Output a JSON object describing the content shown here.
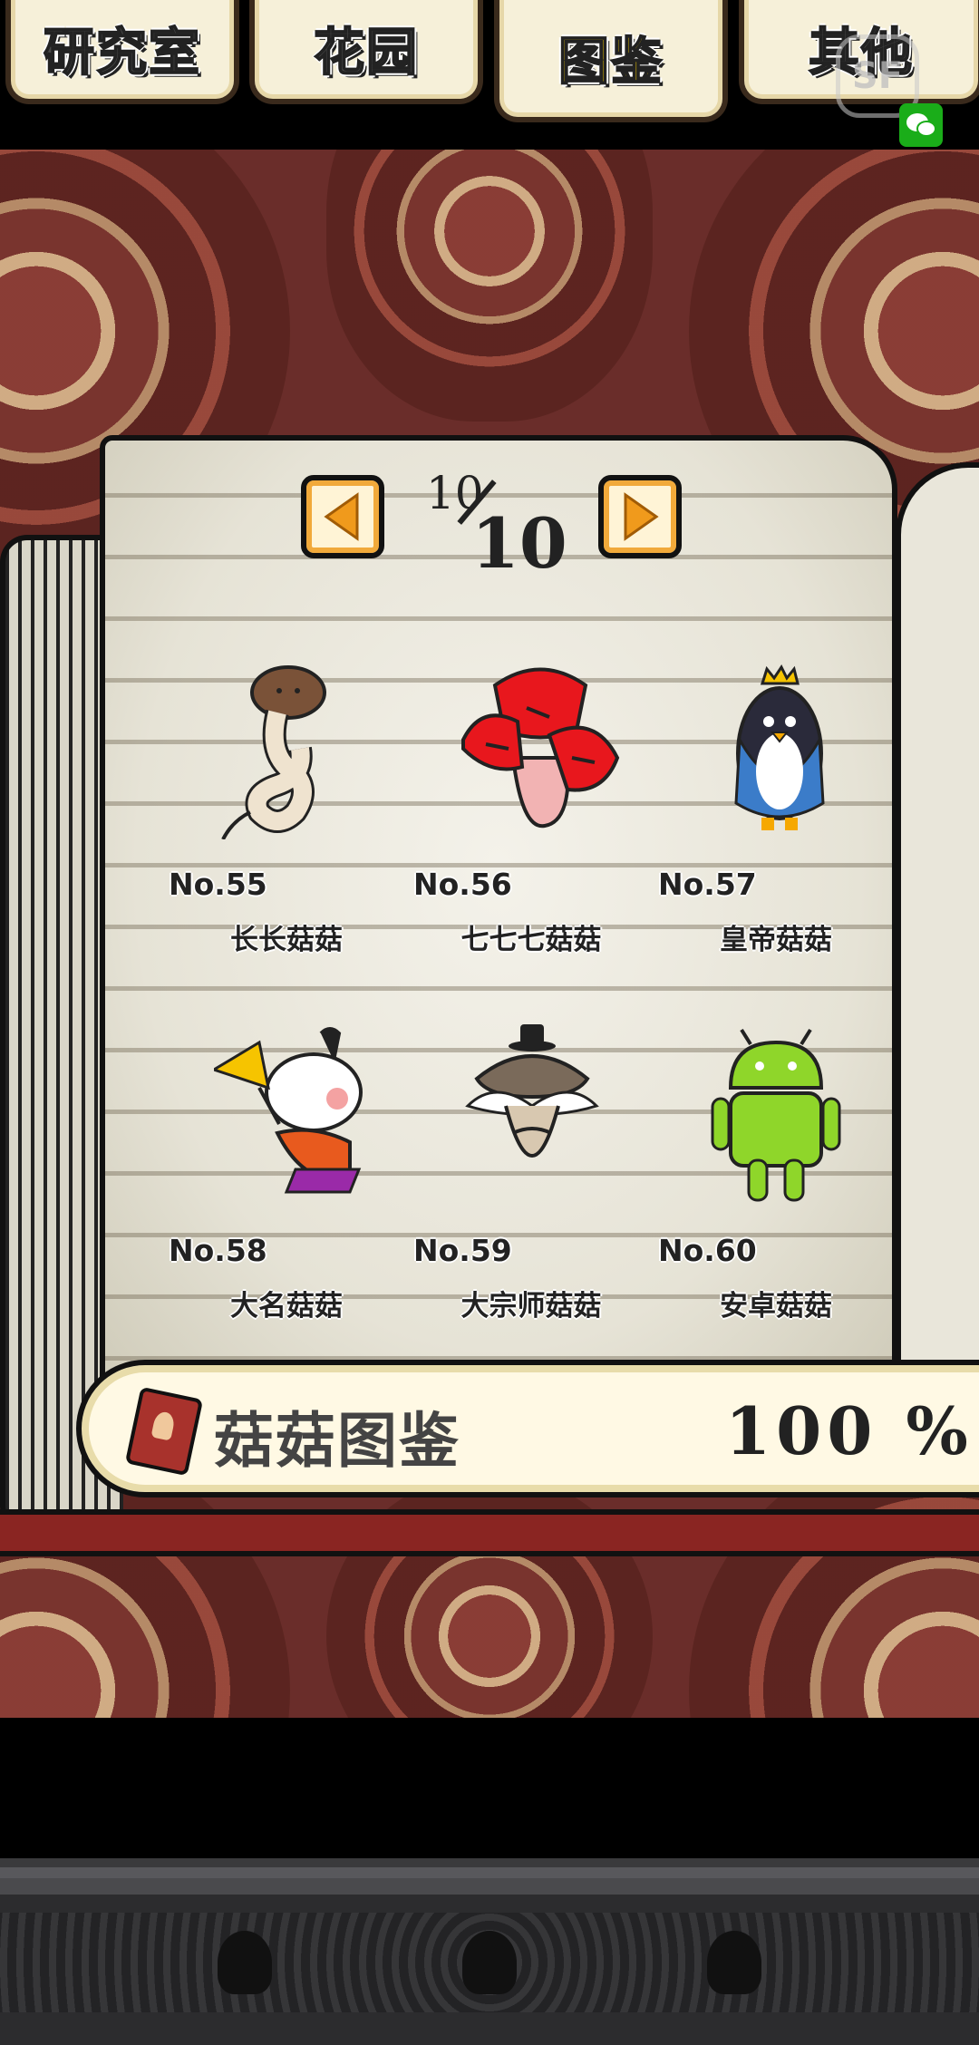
{
  "tabs": [
    {
      "label": "研究室",
      "active": false
    },
    {
      "label": "花园",
      "active": false
    },
    {
      "label": "图鉴",
      "active": true
    },
    {
      "label": "其他",
      "active": false
    }
  ],
  "overlay": {
    "sf_label": "SF"
  },
  "pager": {
    "current": "10",
    "total": "10"
  },
  "entries": [
    {
      "number": "No.55",
      "name": "长长菇菇",
      "icon": "long-mushroom-icon"
    },
    {
      "number": "No.56",
      "name": "七七七菇菇",
      "icon": "red-mushroom-icon"
    },
    {
      "number": "No.57",
      "name": "皇帝菇菇",
      "icon": "emperor-penguin-mushroom-icon"
    },
    {
      "number": "No.58",
      "name": "大名菇菇",
      "icon": "daimyo-mushroom-icon"
    },
    {
      "number": "No.59",
      "name": "大宗师菇菇",
      "icon": "grandmaster-mushroom-icon"
    },
    {
      "number": "No.60",
      "name": "安卓菇菇",
      "icon": "android-mushroom-icon"
    }
  ],
  "progress": {
    "label": "菇菇图鉴",
    "percent": "100 %",
    "value": 100
  },
  "colors": {
    "accent": "#ffd400",
    "page": "#f1eee4",
    "background": "#6a2d2a",
    "cover": "#8a2522"
  }
}
